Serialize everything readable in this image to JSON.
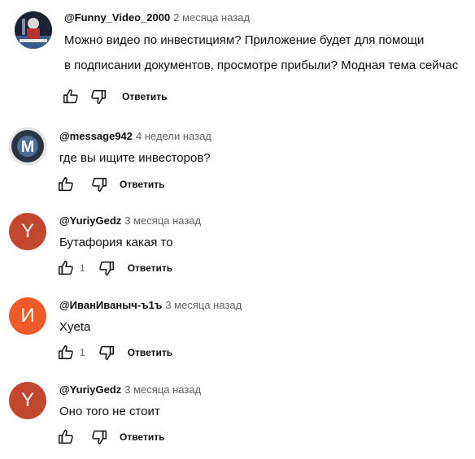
{
  "colors": {
    "author": "#0f0f0f",
    "time": "#606060",
    "avatar_y": "#c1472e",
    "avatar_i": "#ef5a2a"
  },
  "comments": [
    {
      "avatar_type": "image",
      "avatar_icon": "video-thumbnail-avatar",
      "author": "@Funny_Video_2000",
      "time": "2 месяца назад",
      "lines": [
        "Можно видео по инвестициям? Приложение будет для помощи",
        "в подписании документов, просмотре прибыли? Модная тема сейчас"
      ],
      "like_count": "",
      "reply_label": "Ответить"
    },
    {
      "avatar_type": "image",
      "avatar_icon": "m-emblem-avatar",
      "author": "@message942",
      "time": "4 недели назад",
      "lines": [
        "где вы ищите инвесторов?"
      ],
      "like_count": "",
      "reply_label": "Ответить"
    },
    {
      "avatar_type": "letter",
      "avatar_letter": "Y",
      "author": "@YuriyGedz",
      "time": "3 месяца назад",
      "lines": [
        "Бутафория какая то"
      ],
      "like_count": "1",
      "reply_label": "Ответить"
    },
    {
      "avatar_type": "letter",
      "avatar_letter": "И",
      "author": "@ИванИваныч-ъ1ъ",
      "time": "3 месяца назад",
      "lines": [
        "Хyeta"
      ],
      "like_count": "1",
      "reply_label": "Ответить"
    },
    {
      "avatar_type": "letter",
      "avatar_letter": "Y",
      "author": "@YuriyGedz",
      "time": "3 месяца назад",
      "lines": [
        "Оно того не стоит"
      ],
      "like_count": "",
      "reply_label": "Ответить"
    }
  ]
}
